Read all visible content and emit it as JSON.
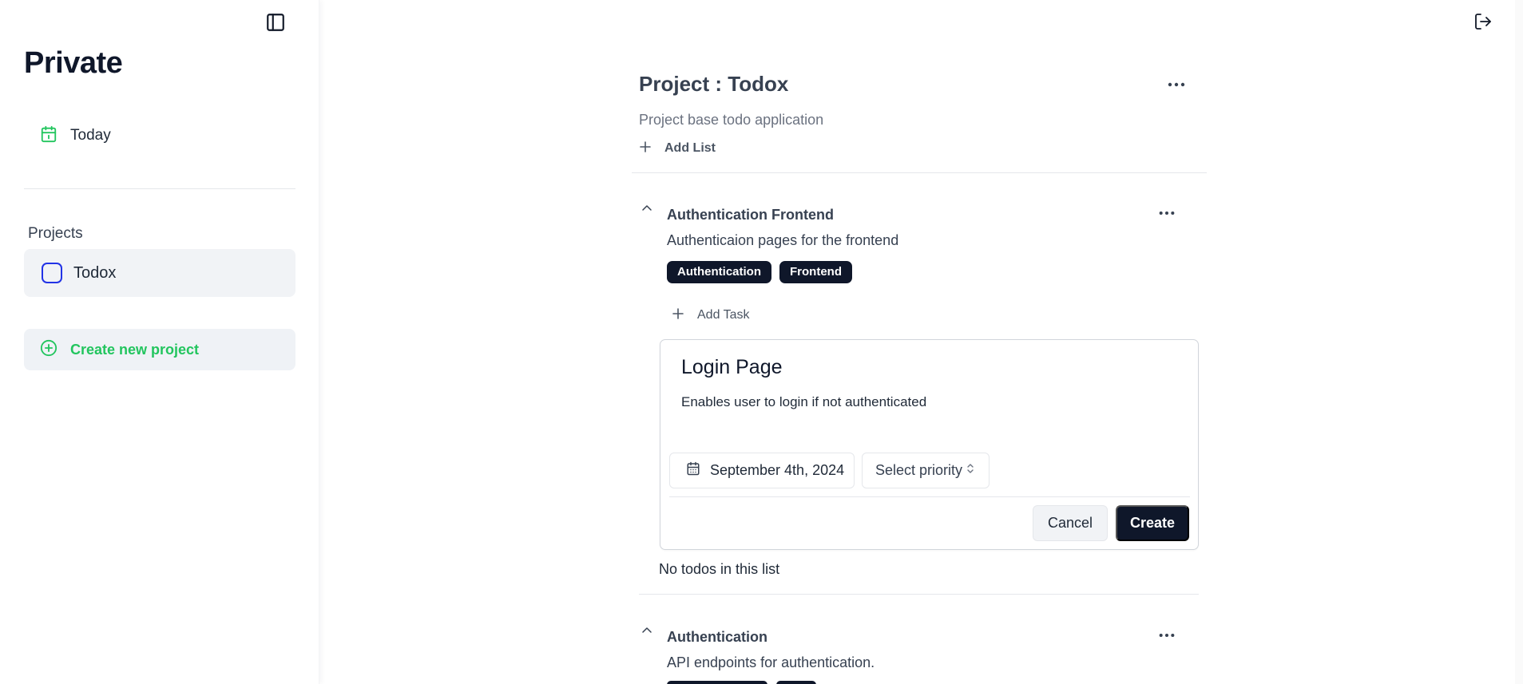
{
  "header": {
    "sidebar_toggle_icon": "panel-left-icon",
    "logout_icon": "logout-icon"
  },
  "sidebar": {
    "workspace_title": "Private",
    "today": {
      "label": "Today",
      "icon": "calendar-icon",
      "icon_color": "#22c55e"
    },
    "projects_heading": "Projects",
    "projects": [
      {
        "name": "Todox",
        "color": "#2233e6"
      }
    ],
    "create_project_label": "Create new project",
    "accent_color": "#22c55e"
  },
  "project": {
    "title": "Project : Todox",
    "description": "Project base todo application",
    "add_list_label": "Add List"
  },
  "lists": [
    {
      "title": "Authentication Frontend",
      "description": "Authenticaion pages for the frontend",
      "tags": [
        "Authentication",
        "Frontend"
      ],
      "add_task_label": "Add Task",
      "empty_text": "No todos in this list",
      "new_task_form": {
        "name_value": "Login Page",
        "description_value": "Enables user to login if not authenticated",
        "date_label": "September 4th, 2024",
        "priority_label": "Select priority",
        "cancel_label": "Cancel",
        "create_label": "Create"
      }
    },
    {
      "title": "Authentication",
      "description": "API endpoints for authentication."
    }
  ]
}
